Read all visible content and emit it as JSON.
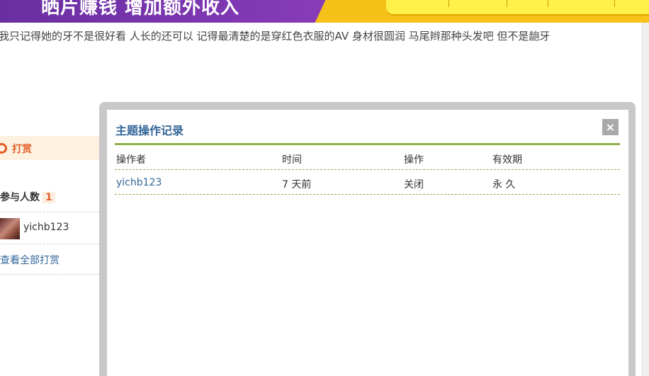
{
  "banner": {
    "slogan": "晒片赚钱 增加额外收入",
    "colors": {
      "purple": "#7b36b0",
      "yellow": "#f6c21a",
      "panel": "#fff04a"
    }
  },
  "post": {
    "text": "我只记得她的牙不是很好看 人长的还可以 记得最清楚的是穿红色衣服的AV 身材很圆润 马尾辫那种头发吧 但不是龅牙"
  },
  "sidebar": {
    "reward_label": "打赏",
    "participants_label": "参与人数",
    "participants_count": "1",
    "user_name": "yichb123",
    "view_all": "查看全部打赏"
  },
  "dialog": {
    "title": "主题操作记录",
    "close_label": "×",
    "columns": [
      "操作者",
      "时间",
      "操作",
      "有效期"
    ],
    "rows": [
      {
        "operator": "yichb123",
        "time": "7 天前",
        "action": "关闭",
        "validity": "永 久"
      }
    ],
    "colors": {
      "title": "#336699",
      "rule": "#8fb04a",
      "accent": "#e45d26"
    }
  }
}
